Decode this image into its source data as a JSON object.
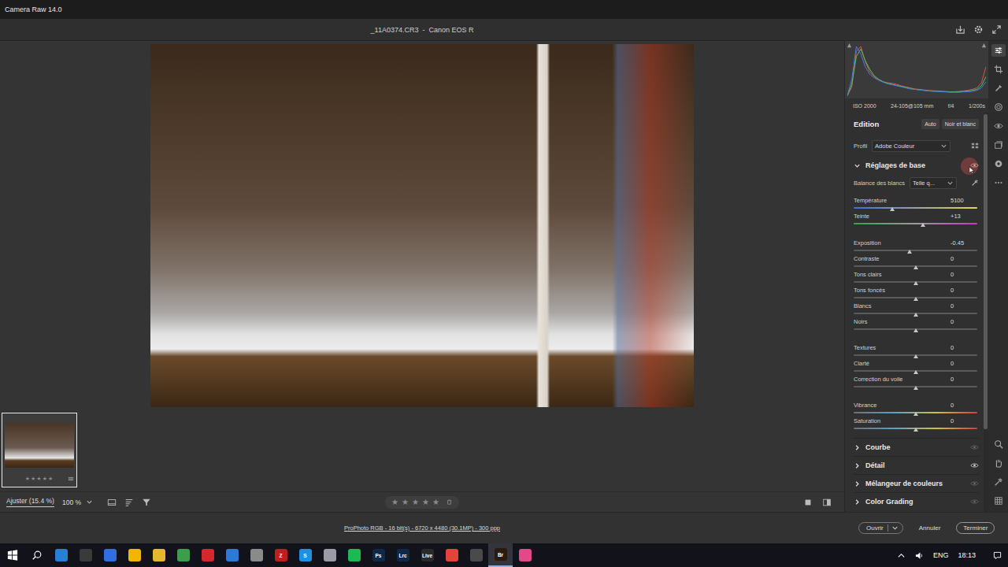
{
  "window": {
    "title": "Camera Raw 14.0",
    "file": "_11A0374.CR3  -  Canon EOS R"
  },
  "histogram": {
    "series": [
      {
        "name": "red",
        "color": "#e0504a",
        "values": [
          2,
          20,
          90,
          100,
          70,
          50,
          40,
          34,
          30,
          28,
          27,
          25,
          22,
          20,
          18,
          16,
          15,
          14,
          13,
          12,
          12,
          11,
          11,
          10,
          10,
          11,
          12,
          13,
          15,
          18,
          28,
          60
        ]
      },
      {
        "name": "green",
        "color": "#4cc35a",
        "values": [
          2,
          25,
          80,
          95,
          72,
          55,
          42,
          35,
          30,
          27,
          25,
          23,
          21,
          19,
          17,
          15,
          14,
          13,
          12,
          12,
          11,
          11,
          10,
          10,
          10,
          10,
          11,
          12,
          13,
          15,
          22,
          40
        ]
      },
      {
        "name": "blue",
        "color": "#4a7de0",
        "values": [
          3,
          35,
          100,
          85,
          60,
          45,
          38,
          33,
          29,
          26,
          24,
          22,
          20,
          18,
          16,
          15,
          14,
          13,
          12,
          11,
          11,
          10,
          10,
          9,
          9,
          9,
          10,
          10,
          11,
          13,
          18,
          30
        ]
      }
    ]
  },
  "camera_info": [
    "ISO 2000",
    "24-105@105 mm",
    "f/4",
    "1/200s"
  ],
  "edit": {
    "title": "Edition",
    "buttons": [
      "Auto",
      "Noir et blanc"
    ]
  },
  "profile": {
    "label": "Profil",
    "value": "Adobe Couleur"
  },
  "basic": {
    "title": "Réglages de base",
    "expanded": true,
    "white_balance": {
      "label": "Balance des blancs",
      "value": "Telle q..."
    },
    "groups": [
      {
        "sliders": [
          {
            "label": "Température",
            "value": "5100",
            "level": 0.31,
            "kind": "temperature"
          },
          {
            "label": "Teinte",
            "value": "+13",
            "level": 0.56,
            "kind": "tint"
          }
        ]
      },
      {
        "sliders": [
          {
            "label": "Exposition",
            "value": "-0.45",
            "level": 0.45,
            "kind": "neutral"
          },
          {
            "label": "Contraste",
            "value": "0",
            "level": 0.5,
            "kind": "neutral"
          },
          {
            "label": "Tons clairs",
            "value": "0",
            "level": 0.5,
            "kind": "neutral"
          },
          {
            "label": "Tons foncés",
            "value": "0",
            "level": 0.5,
            "kind": "neutral"
          },
          {
            "label": "Blancs",
            "value": "0",
            "level": 0.5,
            "kind": "neutral"
          },
          {
            "label": "Noirs",
            "value": "0",
            "level": 0.5,
            "kind": "neutral"
          }
        ]
      },
      {
        "sliders": [
          {
            "label": "Textures",
            "value": "0",
            "level": 0.5,
            "kind": "neutral"
          },
          {
            "label": "Clarté",
            "value": "0",
            "level": 0.5,
            "kind": "neutral"
          },
          {
            "label": "Correction du voile",
            "value": "0",
            "level": 0.5,
            "kind": "neutral"
          }
        ]
      },
      {
        "sliders": [
          {
            "label": "Vibrance",
            "value": "0",
            "level": 0.5,
            "kind": "saturation"
          },
          {
            "label": "Saturation",
            "value": "0",
            "level": 0.5,
            "kind": "saturation"
          }
        ]
      }
    ]
  },
  "sections": [
    {
      "title": "Courbe",
      "expanded": false,
      "modified": false
    },
    {
      "title": "Détail",
      "expanded": false,
      "modified": true
    },
    {
      "title": "Mélangeur de couleurs",
      "expanded": false,
      "modified": false
    },
    {
      "title": "Color Grading",
      "expanded": false,
      "modified": false
    }
  ],
  "filmstrip": [
    {
      "selected": true,
      "stars": 0
    }
  ],
  "toolbar": {
    "fit": "Ajuster (15.4 %)",
    "zoom": "100 %"
  },
  "rating": {
    "glyph": "★",
    "stars": 0,
    "count": 5
  },
  "tools": {
    "top": [
      {
        "kind": "edit",
        "selected": true
      },
      {
        "kind": "crop",
        "selected": false
      },
      {
        "kind": "heal",
        "selected": false
      },
      {
        "kind": "mask",
        "selected": false
      },
      {
        "kind": "redeye",
        "selected": false
      },
      {
        "kind": "presets",
        "selected": false
      },
      {
        "kind": "snapshots",
        "selected": false
      },
      {
        "kind": "more",
        "selected": false
      }
    ],
    "bottom": [
      {
        "kind": "zoom",
        "selected": false
      },
      {
        "kind": "hand",
        "selected": false
      },
      {
        "kind": "sampler",
        "selected": false
      },
      {
        "kind": "grid",
        "selected": false
      }
    ]
  },
  "footer": {
    "info": "ProPhoto RGB - 16 bit(s) - 6720 x 4480 (30.1MP) - 300 ppp",
    "buttons": [
      {
        "label": "Ouvrir",
        "kind": "split"
      },
      {
        "label": "Annuler",
        "kind": "plain"
      },
      {
        "label": "Terminer",
        "kind": "outline"
      }
    ]
  },
  "taskbar": {
    "apps": [
      {
        "color": "#2a7fd4",
        "selected": false
      },
      {
        "color": "#3a3a3a",
        "selected": false
      },
      {
        "color": "#2f6fe0",
        "selected": false
      },
      {
        "color": "#f2b600",
        "selected": false
      },
      {
        "color": "#e8b730",
        "selected": false
      },
      {
        "color": "#3c9d4a",
        "selected": false
      },
      {
        "color": "#d3282e",
        "selected": false
      },
      {
        "color": "#2d7ad6",
        "selected": false
      },
      {
        "color": "#8a8a8a",
        "selected": false
      },
      {
        "color": "#bf1e1e",
        "label": "Z",
        "selected": false
      },
      {
        "color": "#1f8fe0",
        "label": "S",
        "selected": false
      },
      {
        "color": "#9a9aa8",
        "selected": false
      },
      {
        "color": "#1db954",
        "selected": false
      },
      {
        "color": "#0d2a4a",
        "label": "Ps",
        "selected": false
      },
      {
        "color": "#0d2a4a",
        "label": "Lrc",
        "selected": false
      },
      {
        "color": "#2a2a2a",
        "label": "Live",
        "selected": false
      },
      {
        "color": "#e0443a",
        "selected": false
      },
      {
        "color": "#4a4a4a",
        "selected": false
      },
      {
        "color": "#2b1a0e",
        "label": "Br",
        "selected": true
      },
      {
        "color": "#e04a8a",
        "selected": false
      }
    ],
    "lang": "ENG",
    "time": "18:13"
  }
}
